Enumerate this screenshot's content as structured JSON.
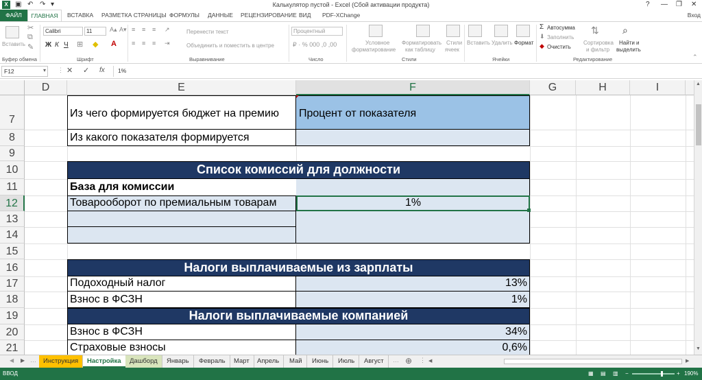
{
  "window": {
    "title": "Калькулятор пустой - Excel (Сбой активации продукта)",
    "logo": "X",
    "help": "?",
    "minimize": "—",
    "restore": "❐",
    "close": "✕"
  },
  "ribbon_tabs": {
    "file": "ФАЙЛ",
    "items": [
      "ГЛАВНАЯ",
      "ВСТАВКА",
      "РАЗМЕТКА СТРАНИЦЫ",
      "ФОРМУЛЫ",
      "ДАННЫЕ",
      "РЕЦЕНЗИРОВАНИЕ",
      "ВИД",
      "PDF-XChange"
    ],
    "signin": "Вход"
  },
  "ribbon": {
    "paste_label": "Вставить",
    "clipboard_group": "Буфер обмена",
    "font_name": "Calibri",
    "font_size": "11",
    "bold": "Ж",
    "italic": "К",
    "underline": "Ч",
    "font_group": "Шрифт",
    "wrap_text": "Перенести текст",
    "merge_center": "Объединить и поместить в центре",
    "alignment_group": "Выравнивание",
    "number_format": "Процентный",
    "number_group": "Число",
    "cond_format_1": "Условное",
    "cond_format_2": "форматирование",
    "format_table_1": "Форматировать",
    "format_table_2": "как таблицу",
    "cell_styles_1": "Стили",
    "cell_styles_2": "ячеек",
    "styles_group": "Стили",
    "insert_label": "Вставить",
    "delete_label": "Удалить",
    "format_label": "Формат",
    "cells_group": "Ячейки",
    "autosum": "Автосумма",
    "fill": "Заполнить",
    "clear": "Очистить",
    "sort_1": "Сортировка",
    "sort_2": "и фильтр",
    "find_1": "Найти и",
    "find_2": "выделить",
    "editing_group": "Редактирование"
  },
  "formula_bar": {
    "name_box": "F12",
    "cancel": "✕",
    "enter": "✓",
    "fx": "fx",
    "value": "1%"
  },
  "columns": [
    "D",
    "E",
    "F",
    "G",
    "H",
    "I"
  ],
  "rows": [
    "7",
    "8",
    "9",
    "10",
    "11",
    "12",
    "13",
    "14",
    "15",
    "16",
    "17",
    "18",
    "19",
    "20",
    "21"
  ],
  "cells": {
    "e7": "Из чего формируется бюджет на премию",
    "f7": "Процент от показателя",
    "e8": "Из какого показателя формируется",
    "h10": "Список комиссий для должности",
    "e11": "База для комиссии",
    "e12": "Товарооборот по премиальным товарам",
    "f12": "1%",
    "h16": "Налоги выплачиваемые из зарплаты",
    "e17": "Подоходный налог",
    "f17": "13%",
    "e18": "Взнос в ФСЗН",
    "f18": "1%",
    "h19": "Налоги выплачиваемые компанией",
    "e20": "Взнос в ФСЗН",
    "f20": "34%",
    "e21": "Страховые взносы",
    "f21": "0,6%"
  },
  "colors": {
    "header_blue": "#1f3864",
    "light_blue": "#dce6f1",
    "mid_blue": "#9bc2e6",
    "excel_green": "#217346"
  },
  "sheets": [
    "Инструкция",
    "Настройка",
    "Дашборд",
    "Январь",
    "Февраль",
    "Март",
    "Апрель",
    "Май",
    "Июнь",
    "Июль",
    "Август"
  ],
  "status": {
    "mode": "ВВОД",
    "zoom": "190%"
  }
}
